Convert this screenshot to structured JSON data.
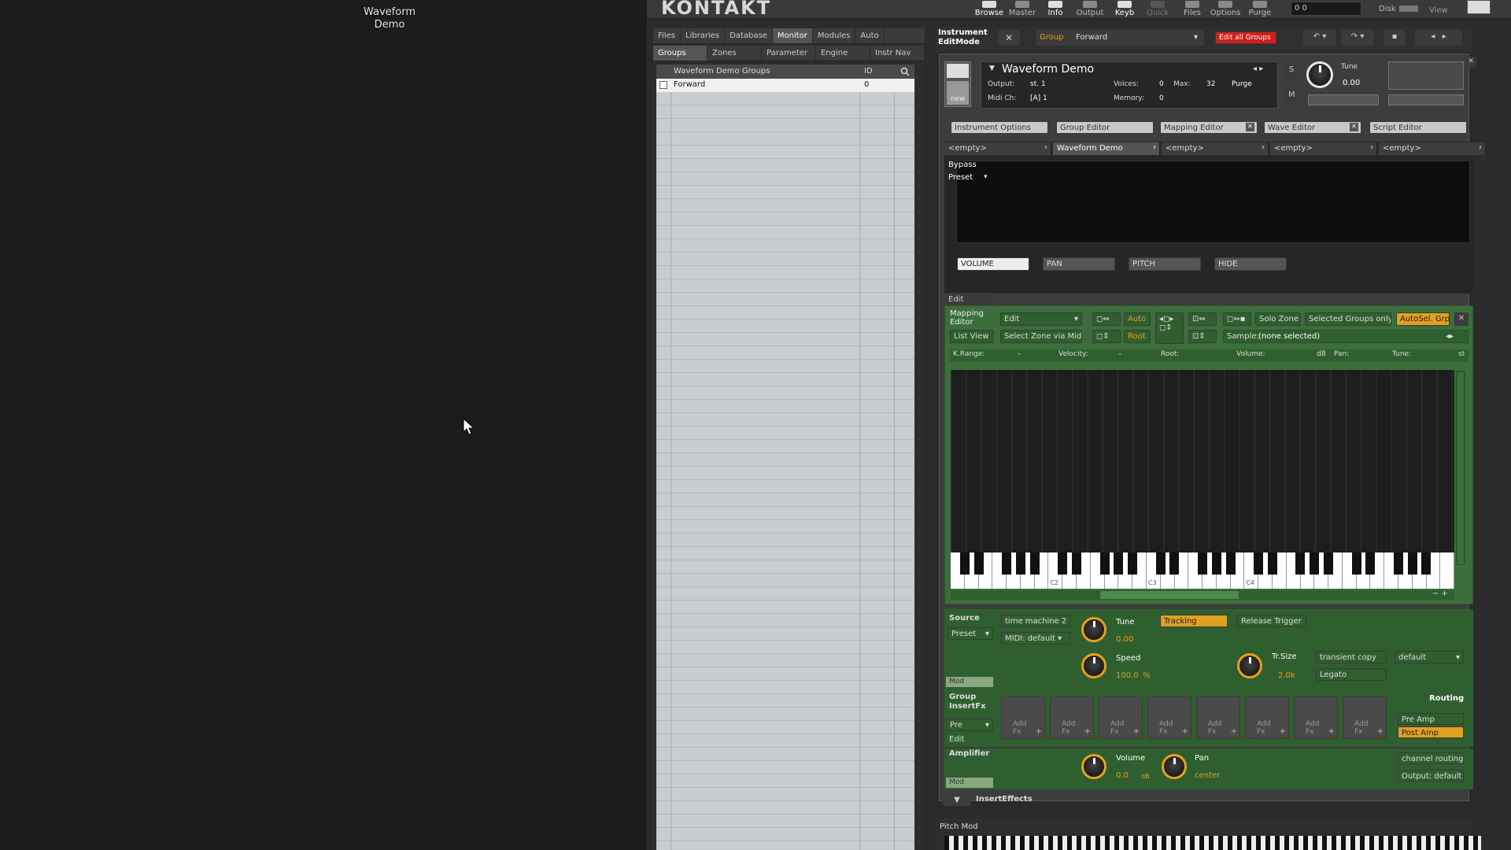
{
  "desktop": {
    "label": "Waveform\nDemo",
    "label_line1": "Waveform",
    "label_line2": "Demo"
  },
  "app": {
    "name": "KONTAKT"
  },
  "toolbar": {
    "items": [
      {
        "label": "Browse",
        "state": "on"
      },
      {
        "label": "Master",
        "state": "off"
      },
      {
        "label": "Info",
        "state": "on"
      },
      {
        "label": "Output",
        "state": "off"
      },
      {
        "label": "Keyb",
        "state": "on"
      },
      {
        "label": "Quick",
        "state": "dim"
      },
      {
        "label": "Files",
        "state": "off"
      },
      {
        "label": "Options",
        "state": "off"
      },
      {
        "label": "Purge",
        "state": "off"
      }
    ],
    "cpu": "0 0",
    "disk": "Disk",
    "view": "View"
  },
  "browser": {
    "tabs": [
      "Files",
      "Libraries",
      "Database",
      "Monitor",
      "Modules",
      "Auto"
    ],
    "active_tab": "Monitor",
    "subtabs": [
      "Groups",
      "Zones",
      "Parameter",
      "Engine",
      "Instr Nav"
    ],
    "columns": {
      "name": "Waveform Demo Groups",
      "id": "ID"
    },
    "rows": [
      {
        "name": "Forward",
        "id": "0"
      }
    ]
  },
  "edit": {
    "title_line1": "Instrument",
    "title_line2": "EditMode",
    "group_label": "Group",
    "group_value": "Forward",
    "edit_all_groups": "Edit all Groups"
  },
  "instrument": {
    "name": "Waveform Demo",
    "output_label": "Output:",
    "output": "st. 1",
    "voices_label": "Voices:",
    "voices": "0",
    "max_label": "Max:",
    "max": "32",
    "purge": "Purge",
    "midi_label": "Midi Ch:",
    "midi": "[A] 1",
    "memory_label": "Memory:",
    "memory": "0",
    "tune_label": "Tune",
    "tune": "0.00",
    "new_label": "new",
    "s": "S",
    "m": "M"
  },
  "editor_tabs": [
    "Instrument Options",
    "Group Editor",
    "Mapping Editor",
    "Wave Editor",
    "Script Editor"
  ],
  "script_slots": [
    "<empty>",
    "Waveform Demo",
    "<empty>",
    "<empty>",
    "<empty>"
  ],
  "script": {
    "bypass": "Bypass",
    "preset": "Preset",
    "buttons": [
      "VOLUME",
      "PAN",
      "PITCH",
      "HIDE"
    ],
    "edit": "Edit"
  },
  "mapping": {
    "title": "Mapping Editor",
    "edit_menu": "Edit",
    "list_view": "List View",
    "select_zone": "Select Zone via Midi",
    "auto": "Auto",
    "root": "Root",
    "solo_zone": "Solo Zone",
    "selected_groups_only": "Selected Groups only",
    "autosel_grp": "AutoSel. Grp",
    "sample_label": "Sample:",
    "sample_value": "(none selected)",
    "krange": "K.Range:",
    "krange_val": "–",
    "velocity": "Velocity:",
    "velocity_val": "–",
    "root_label": "Root:",
    "volume_label": "Volume:",
    "db": "dB",
    "pan_label": "Pan:",
    "tune_label": "Tune:",
    "st": "st",
    "octaves": [
      "C2",
      "C3",
      "C4"
    ]
  },
  "source": {
    "label": "Source",
    "preset": "Preset",
    "mode": "time machine 2",
    "midi": "MIDI: default",
    "tune_label": "Tune",
    "tune": "0.00",
    "speed_label": "Speed",
    "speed": "100.0",
    "percent": "%",
    "tracking": "Tracking",
    "release_trigger": "Release Trigger",
    "trsize_label": "Tr.Size",
    "trsize": "2.0k",
    "transient_copy": "transient copy",
    "default": "default",
    "legato": "Legato",
    "mod": "Mod"
  },
  "insert_fx": {
    "label_line1": "Group",
    "label_line2": "InsertFx",
    "pre": "Pre",
    "edit": "Edit",
    "slot_label_line1": "Add",
    "slot_label_line2": "Fx",
    "routing": "Routing",
    "pre_amp": "Pre Amp",
    "post_amp": "Post Amp"
  },
  "amplifier": {
    "label": "Amplifier",
    "volume_label": "Volume",
    "volume": "0.0",
    "db": "dB",
    "pan_label": "Pan",
    "pan": "center",
    "channel_routing": "channel routing",
    "output": "Output: default",
    "mod": "Mod"
  },
  "insert_effects": "InsertEffects",
  "pitch_mod": "Pitch Mod",
  "colors": {
    "accent": "#e0a020",
    "panel_green": "#3b6e3b",
    "red_button": "#d0201c"
  }
}
